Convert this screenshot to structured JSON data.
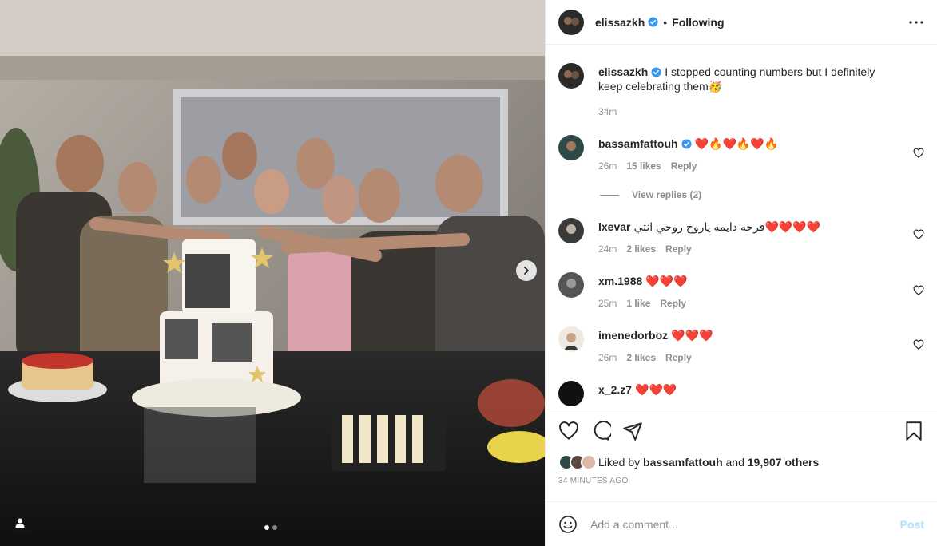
{
  "post": {
    "username": "elissazkh",
    "separator": "•",
    "follow_status": "Following",
    "caption": "I stopped counting numbers but I definitely keep celebrating them🥳",
    "caption_time": "34m"
  },
  "comments": [
    {
      "username": "bassamfattouh",
      "verified": true,
      "text": "❤️🔥❤️🔥❤️🔥",
      "time": "26m",
      "likes": "15 likes",
      "reply": "Reply",
      "view_replies": "View replies (2)"
    },
    {
      "username": "lxevar",
      "text": "فرحه دايمه ياروح روحي انتي❤️❤️❤️❤️",
      "time": "24m",
      "likes": "2 likes",
      "reply": "Reply"
    },
    {
      "username": "xm.1988",
      "text": "❤️❤️❤️",
      "time": "25m",
      "likes": "1 like",
      "reply": "Reply"
    },
    {
      "username": "imenedorboz",
      "text": "❤️❤️❤️",
      "time": "26m",
      "likes": "2 likes",
      "reply": "Reply"
    },
    {
      "username": "x_2.z7",
      "text": "❤️❤️❤️",
      "time": "",
      "likes": "",
      "reply": ""
    }
  ],
  "likes": {
    "prefix": "Liked by",
    "user": "bassamfattouh",
    "and": "and",
    "others": "19,907 others"
  },
  "posted_ago": "34 MINUTES AGO",
  "add_comment": {
    "placeholder": "Add a comment...",
    "post_label": "Post"
  },
  "icons": {
    "like": "heart-icon",
    "comment": "comment-icon",
    "share": "share-icon",
    "save": "bookmark-icon",
    "more": "more-icon",
    "next": "chevron-right-icon",
    "tag": "user-tag-icon",
    "emoji": "emoji-icon"
  },
  "colors": {
    "verified": "#3897f0",
    "post_disabled": "#b2dffc",
    "muted": "#8e8e8e"
  }
}
